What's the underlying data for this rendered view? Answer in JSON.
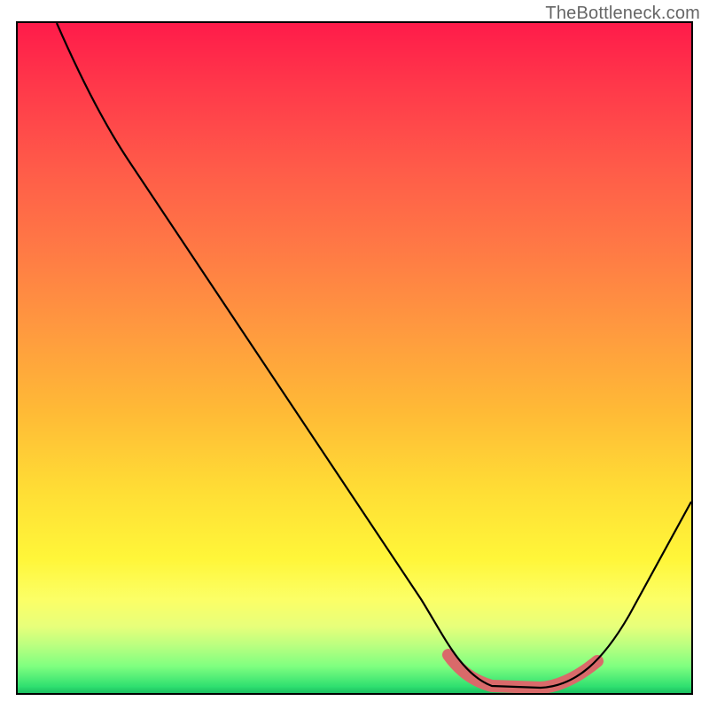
{
  "watermark": "TheBottleneck.com",
  "chart_data": {
    "type": "line",
    "title": "",
    "xlabel": "",
    "ylabel": "",
    "xlim": [
      0,
      100
    ],
    "ylim": [
      0,
      100
    ],
    "grid": false,
    "legend": false,
    "gradient": {
      "orientation": "vertical",
      "stops": [
        {
          "pos": 0,
          "color": "#ff1b4a"
        },
        {
          "pos": 50,
          "color": "#ffba36"
        },
        {
          "pos": 85,
          "color": "#fff639"
        },
        {
          "pos": 100,
          "color": "#1ac060"
        }
      ]
    },
    "series": [
      {
        "name": "bottleneck-curve",
        "stroke": "#000000",
        "points": [
          {
            "x": 6,
            "y": 100
          },
          {
            "x": 10,
            "y": 92
          },
          {
            "x": 16,
            "y": 82
          },
          {
            "x": 60,
            "y": 14
          },
          {
            "x": 66,
            "y": 4
          },
          {
            "x": 70,
            "y": 1
          },
          {
            "x": 78,
            "y": 1
          },
          {
            "x": 84,
            "y": 3
          },
          {
            "x": 90,
            "y": 12
          },
          {
            "x": 100,
            "y": 30
          }
        ]
      },
      {
        "name": "optimal-zone-highlight",
        "stroke": "#d96a6a",
        "strokeWidth": 10,
        "points": [
          {
            "x": 64,
            "y": 6
          },
          {
            "x": 68,
            "y": 2
          },
          {
            "x": 72,
            "y": 1
          },
          {
            "x": 78,
            "y": 1
          },
          {
            "x": 82,
            "y": 2
          },
          {
            "x": 86,
            "y": 5
          }
        ]
      }
    ]
  }
}
